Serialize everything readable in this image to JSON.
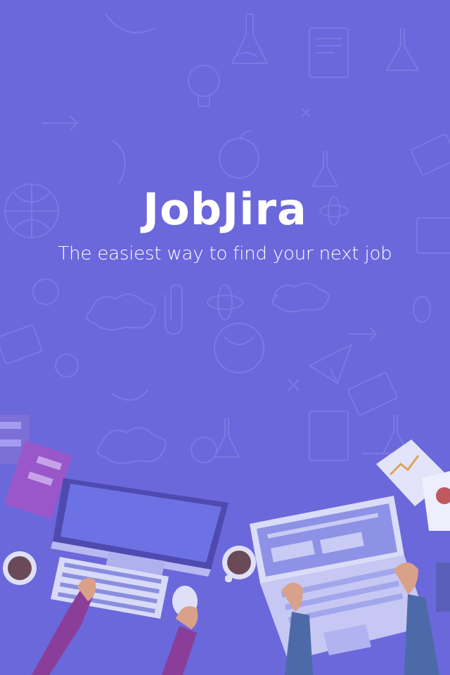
{
  "app": {
    "logo_text": "JobJira",
    "tagline": "The easiest way to find your next job"
  },
  "theme": {
    "background": "#6b68db",
    "doodle_stroke": "#7f7ce6",
    "text": "#ffffff"
  },
  "illustration": {
    "items": [
      "monitor",
      "keyboard",
      "coffee-cup",
      "mouse",
      "laptop",
      "notebook",
      "charts-paper",
      "hands"
    ]
  }
}
